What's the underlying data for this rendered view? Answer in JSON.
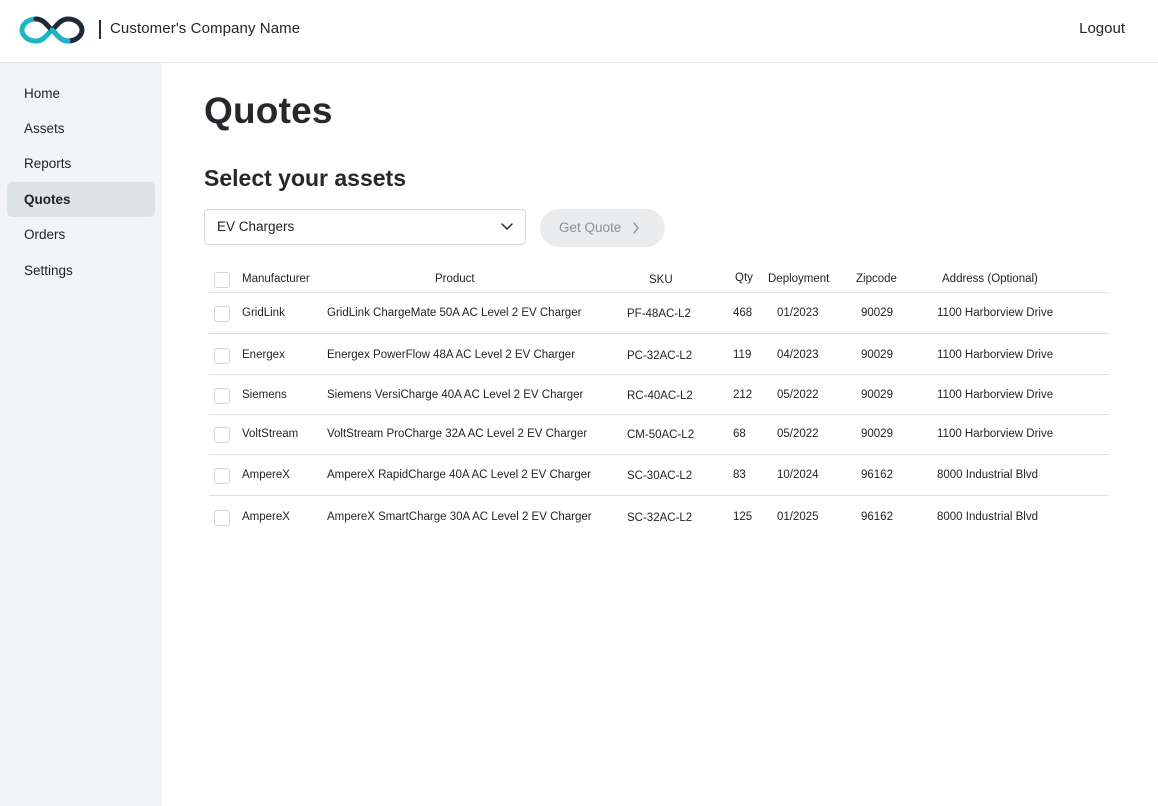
{
  "header": {
    "company_name": "Customer's Company Name",
    "logout_label": "Logout"
  },
  "sidebar": {
    "items": [
      {
        "label": "Home"
      },
      {
        "label": "Assets"
      },
      {
        "label": "Reports"
      },
      {
        "label": "Quotes",
        "active": true
      },
      {
        "label": "Orders"
      },
      {
        "label": "Settings"
      }
    ]
  },
  "main": {
    "title": "Quotes",
    "section_title": "Select your assets",
    "asset_type_select": {
      "value": "EV Chargers"
    },
    "get_quote_label": "Get Quote"
  },
  "table": {
    "columns": [
      "Manufacturer",
      "Product",
      "SKU",
      "Qty",
      "Deployment",
      "Zipcode",
      "Address (Optional)"
    ],
    "rows": [
      {
        "manufacturer": "GridLink",
        "product": "GridLink ChargeMate 50A AC Level 2 EV Charger",
        "sku": "PF-48AC-L2",
        "qty": "468",
        "deployment": "01/2023",
        "zipcode": "90029",
        "address": "1100 Harborview Drive"
      },
      {
        "manufacturer": "Energex",
        "product": "Energex PowerFlow 48A AC Level 2 EV Charger",
        "sku": "PC-32AC-L2",
        "qty": "119",
        "deployment": "04/2023",
        "zipcode": "90029",
        "address": "1100 Harborview Drive"
      },
      {
        "manufacturer": "Siemens",
        "product": "Siemens VersiCharge 40A AC Level 2 EV Charger",
        "sku": "RC-40AC-L2",
        "qty": "212",
        "deployment": "05/2022",
        "zipcode": "90029",
        "address": "1100 Harborview Drive"
      },
      {
        "manufacturer": "VoltStream",
        "product": "VoltStream ProCharge 32A AC Level 2 EV Charger",
        "sku": "CM-50AC-L2",
        "qty": "68",
        "deployment": "05/2022",
        "zipcode": "90029",
        "address": "1100 Harborview Drive"
      },
      {
        "manufacturer": "AmpereX",
        "product": "AmpereX RapidCharge 40A AC Level 2 EV Charger",
        "sku": "SC-30AC-L2",
        "qty": "83",
        "deployment": "10/2024",
        "zipcode": "96162",
        "address": "8000 Industrial Blvd"
      },
      {
        "manufacturer": "AmpereX",
        "product": "AmpereX SmartCharge 30A AC Level 2 EV Charger",
        "sku": "SC-32AC-L2",
        "qty": "125",
        "deployment": "01/2025",
        "zipcode": "96162",
        "address": "8000 Industrial Blvd"
      }
    ]
  },
  "colors": {
    "logo_teal": "#1bb5c6",
    "logo_dark": "#1e2a38",
    "sidebar_bg": "#f2f4f5",
    "active_nav_bg": "#dde3e5",
    "button_disabled_bg": "#e9ebed"
  },
  "icons": [
    "infinity-logo",
    "chevron-down-icon",
    "chevron-right-icon"
  ]
}
